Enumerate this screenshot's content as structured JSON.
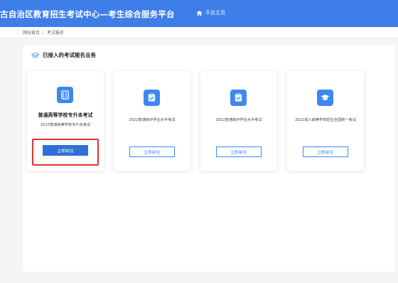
{
  "header": {
    "title": "古自治区教育招生考试中心—考生综合服务平台",
    "home_label": "平台主页",
    "bg_color": "#3d7ee8"
  },
  "breadcrumb": {
    "items": [
      "网站首页",
      "考试报名"
    ],
    "separator": "/"
  },
  "panel": {
    "heading": "已接入的考试报名业务",
    "heading_icon": "graduation-cap-icon"
  },
  "cards": [
    {
      "title": "普通高等学校专升本考试",
      "subtitle": "2023普通高等学校专升本考试",
      "button": "立即前往",
      "icon": "document-list-icon",
      "highlighted": true
    },
    {
      "title": "",
      "subtitle": "2022普通高中学业水平考试",
      "button": "立即前往",
      "icon": "checklist-icon",
      "highlighted": false
    },
    {
      "title": "",
      "subtitle": "2022普通高中学业水平考试",
      "button": "立即前往",
      "icon": "checklist-icon",
      "highlighted": false
    },
    {
      "title": "",
      "subtitle": "2022成人高等学校招生全国统一考试",
      "button": "立即前往",
      "icon": "graduation-cap-icon",
      "highlighted": false
    }
  ],
  "colors": {
    "accent": "#3d88ee",
    "highlight_border": "#e0352b"
  }
}
